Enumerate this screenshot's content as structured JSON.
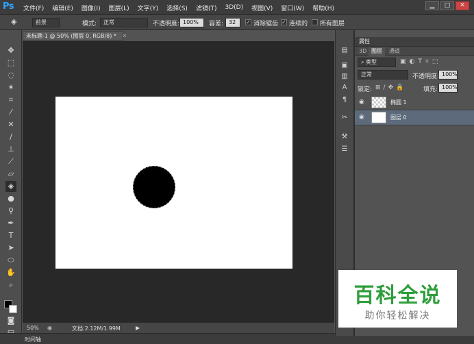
{
  "app": {
    "logo": "Ps"
  },
  "menu": [
    "文件(F)",
    "编辑(E)",
    "图像(I)",
    "图层(L)",
    "文字(Y)",
    "选择(S)",
    "滤镜(T)",
    "3D(D)",
    "视图(V)",
    "窗口(W)",
    "帮助(H)"
  ],
  "window_buttons": {
    "minimize": "▁",
    "maximize": "□",
    "close": "✕"
  },
  "options": {
    "fill_source": "前景",
    "mode_label": "模式:",
    "mode_value": "正常",
    "opacity_label": "不透明度:",
    "opacity_value": "100%",
    "tolerance_label": "容差:",
    "tolerance_value": "32",
    "antialias_label": "消除锯齿",
    "contiguous_label": "连续的",
    "all_layers_label": "所有图层"
  },
  "document": {
    "tab_title": "未标题-1 @ 50% (图层 0, RGB/8) *",
    "zoom": "50%",
    "doc_info": "文档:2.12M/1.99M"
  },
  "timeline_label": "时间轴",
  "panels": {
    "properties_label": "属性",
    "tabs": [
      "3D",
      "图层",
      "通道"
    ],
    "active_tab": "图层",
    "filter_label": "类型",
    "blend_mode": "正常",
    "opacity_label": "不透明度:",
    "opacity_value": "100%",
    "lock_label": "锁定:",
    "fill_label": "填充:",
    "fill_value": "100%",
    "layers": [
      {
        "name": "椭圆 1",
        "selected": false
      },
      {
        "name": "图层 0",
        "selected": true
      }
    ]
  },
  "watermark": {
    "title": "百科全说",
    "subtitle": "助你轻松解决"
  },
  "colors": {
    "accent": "#2fa3ff",
    "selection": "#5d6a7b",
    "watermark_green": "#2e9e3a"
  }
}
